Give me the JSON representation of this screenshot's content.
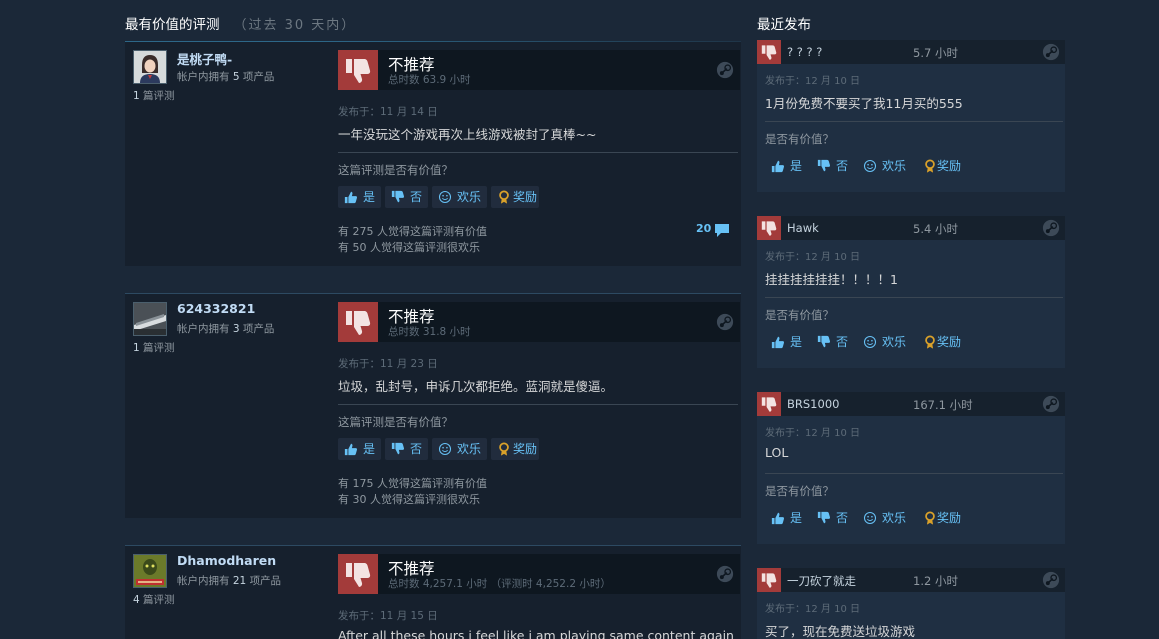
{
  "left": {
    "title": "最有价值的评测",
    "subtitle": "（过去 30 天内）",
    "reviews": [
      {
        "username": "是桃子鸭-",
        "owns_prefix": "帐户内拥有",
        "owns_count": "5",
        "owns_suffix": "项产品",
        "review_count": "1",
        "review_label": "篇评测",
        "verdict": "不推荐",
        "hours": "总时数 63.9 小时",
        "posted": "发布于：11 月 14 日",
        "content": "一年没玩这个游戏再次上线游戏被封了真棒~~",
        "helpful_question": "这篇评测是否有价值？",
        "buttons": {
          "yes": "是",
          "no": "否",
          "funny": "欢乐",
          "award": "奖励"
        },
        "helpful_stat": "有 275 人觉得这篇评测有价值",
        "funny_stat": "有 50 人觉得这篇评测很欢乐",
        "comments": "20"
      },
      {
        "username": "624332821",
        "owns_prefix": "帐户内拥有",
        "owns_count": "3",
        "owns_suffix": "项产品",
        "review_count": "1",
        "review_label": "篇评测",
        "verdict": "不推荐",
        "hours": "总时数 31.8 小时",
        "posted": "发布于：11 月 23 日",
        "content": "垃圾，乱封号，申诉几次都拒绝。蓝洞就是傻逼。",
        "helpful_question": "这篇评测是否有价值？",
        "buttons": {
          "yes": "是",
          "no": "否",
          "funny": "欢乐",
          "award": "奖励"
        },
        "helpful_stat": "有 175 人觉得这篇评测有价值",
        "funny_stat": "有 30 人觉得这篇评测很欢乐"
      },
      {
        "username": "Dhamodharen",
        "owns_prefix": "帐户内拥有",
        "owns_count": "21",
        "owns_suffix": "项产品",
        "review_count": "4",
        "review_label": "篇评测",
        "verdict": "不推荐",
        "hours": "总时数 4,257.1 小时 （评测时 4,252.2 小时）",
        "posted": "发布于：11 月 15 日",
        "content": "After all these hours i feel like i am playing same content again"
      }
    ]
  },
  "right": {
    "title": "最近发布",
    "recent": [
      {
        "name": "? ? ? ?",
        "hours": "5.7 小时",
        "posted": "发布于：12 月 10 日",
        "content": "1月份免费不要买了我11月买的555",
        "question": "是否有价值？",
        "buttons": {
          "yes": "是",
          "no": "否",
          "funny": "欢乐",
          "award": "奖励"
        }
      },
      {
        "name": "Hawk",
        "hours": "5.4 小时",
        "posted": "发布于：12 月 10 日",
        "content": "挂挂挂挂挂挂！！！！1",
        "question": "是否有价值？",
        "buttons": {
          "yes": "是",
          "no": "否",
          "funny": "欢乐",
          "award": "奖励"
        }
      },
      {
        "name": "BRS1000",
        "hours": "167.1 小时",
        "posted": "发布于：12 月 10 日",
        "content": "LOL",
        "question": "是否有价值？",
        "buttons": {
          "yes": "是",
          "no": "否",
          "funny": "欢乐",
          "award": "奖励"
        }
      },
      {
        "name": "一刀砍了就走",
        "hours": "1.2 小时",
        "posted": "发布于：12 月 10 日",
        "content": "买了，现在免费送垃圾游戏"
      }
    ]
  },
  "colors": {
    "page_bg": "#1b2838",
    "card_bg": "#16202d",
    "not_recommended": "#a33b3a",
    "link_blue": "#67c1f5",
    "award_gold": "#d9a12a"
  }
}
